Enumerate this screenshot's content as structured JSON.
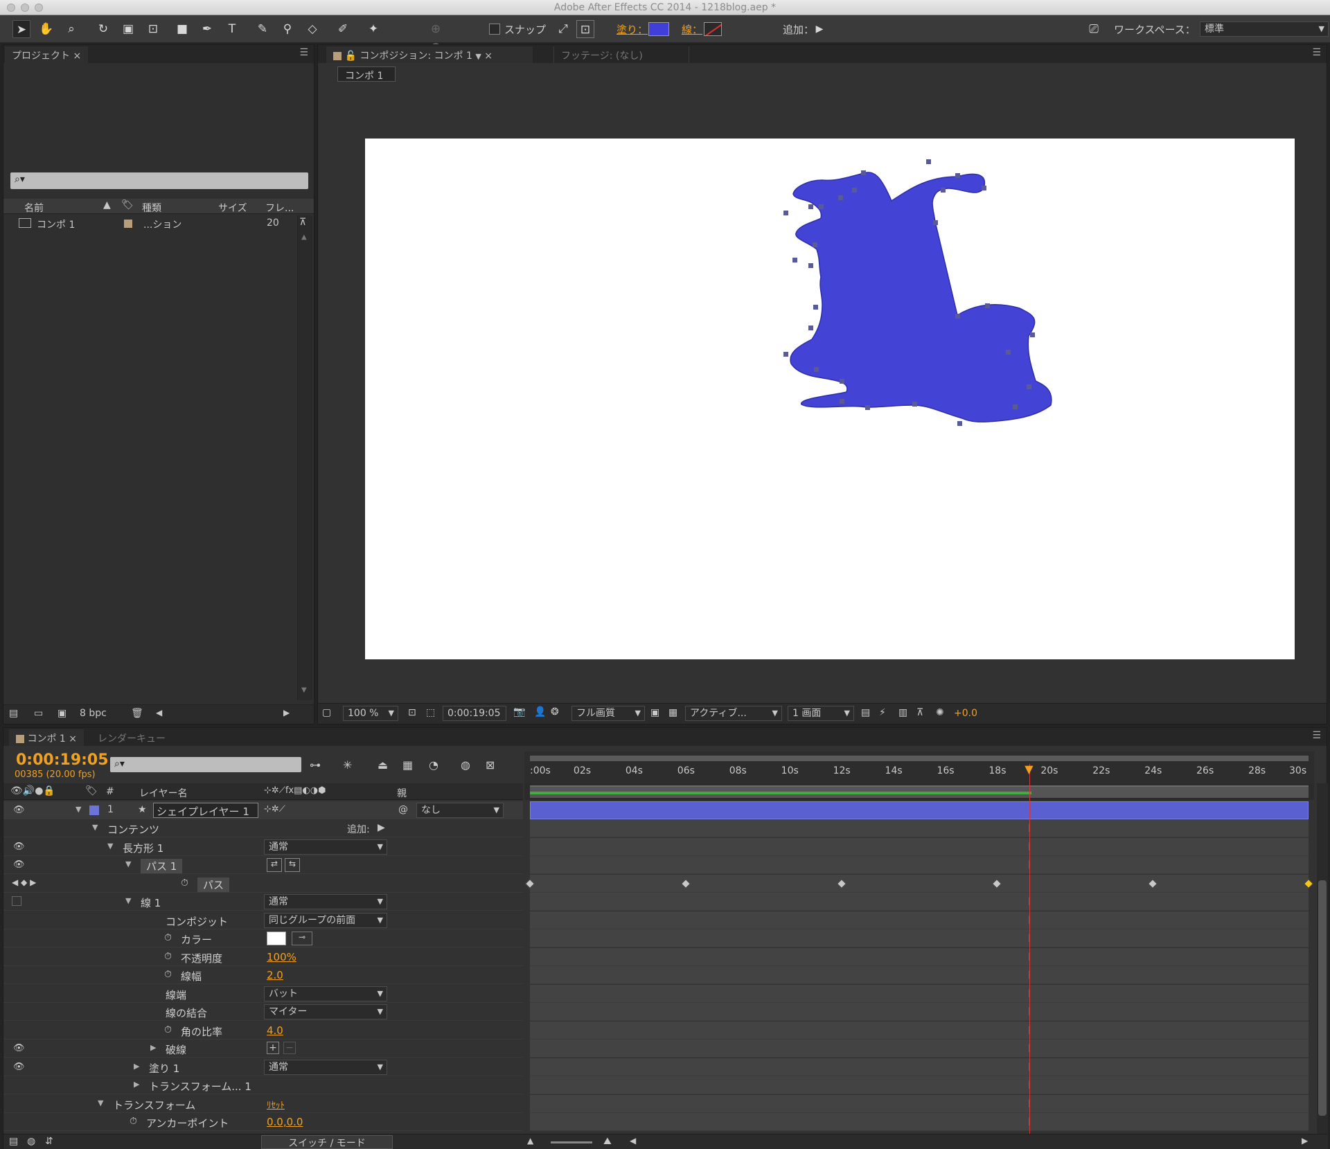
{
  "app": {
    "window_title": "Adobe After Effects CC 2014 - 1218blog.aep *"
  },
  "toolbar": {
    "snap_label": "スナップ",
    "fill_label": "塗り：",
    "stroke_label": "線：",
    "add_label": "追加：",
    "workspace_label": "ワークスペース：",
    "workspace_value": "標準",
    "fill_color": "#4040d8"
  },
  "project_panel": {
    "tab_label": "プロジェクト",
    "search_placeholder": "",
    "columns": [
      "名前",
      "種類",
      "サイズ",
      "フレ..."
    ],
    "items": [
      {
        "name": "コンポ 1",
        "type": "...ション",
        "frame_rate": "20"
      }
    ],
    "bpc_label": "8 bpc"
  },
  "comp_panel": {
    "tab_label": "コンポジション: コンポ 1",
    "footage_tab_label": "フッテージ: (なし)",
    "breadcrumb": "コンポ 1",
    "shape_color": "#4343d6",
    "footer": {
      "zoom": "100 %",
      "timecode": "0:00:19:05",
      "quality": "フル画質",
      "camera": "アクティブ...",
      "views": "1 画面",
      "exposure": "+0.0"
    }
  },
  "timeline_panel": {
    "tab_label": "コンポ 1",
    "render_tab_label": "レンダーキュー",
    "current_time": "0:00:19:05",
    "frame_info": "00385 (20.00 fps)",
    "column_headers": {
      "num": "#",
      "layer_name": "レイヤー名",
      "parent": "親"
    },
    "ruler_ticks": [
      ":00s",
      "02s",
      "04s",
      "06s",
      "08s",
      "10s",
      "12s",
      "14s",
      "16s",
      "18s",
      "20s",
      "22s",
      "24s",
      "26s",
      "28s",
      "30s"
    ],
    "playhead_seconds": 19.25,
    "duration_seconds": 30,
    "layer": {
      "index": "1",
      "name": "シェイプレイヤー 1",
      "parent": "なし"
    },
    "rows": [
      {
        "label": "コンテンツ",
        "value": "追加:"
      },
      {
        "label": "長方形 1",
        "value": "通常"
      },
      {
        "label": "パス 1",
        "value": ""
      },
      {
        "label": "パス",
        "value": ""
      },
      {
        "label": "線 1",
        "value": "通常"
      },
      {
        "label": "コンポジット",
        "value": "同じグループの前面"
      },
      {
        "label": "カラー",
        "value": ""
      },
      {
        "label": "不透明度",
        "value": "100%"
      },
      {
        "label": "線幅",
        "value": "2.0"
      },
      {
        "label": "線端",
        "value": "バット"
      },
      {
        "label": "線の結合",
        "value": "マイター"
      },
      {
        "label": "角の比率",
        "value": "4.0"
      },
      {
        "label": "破線",
        "value": ""
      },
      {
        "label": "塗り 1",
        "value": "通常"
      },
      {
        "label": "トランスフォーム... 1",
        "value": ""
      },
      {
        "label": "トランスフォーム",
        "value": "ﾘｾｯﾄ"
      },
      {
        "label": "アンカーポイント",
        "value": "0.0,0.0"
      }
    ],
    "keyframe_seconds": [
      0,
      6,
      12,
      18,
      24,
      30
    ],
    "switch_mode_label": "スイッチ / モード"
  }
}
